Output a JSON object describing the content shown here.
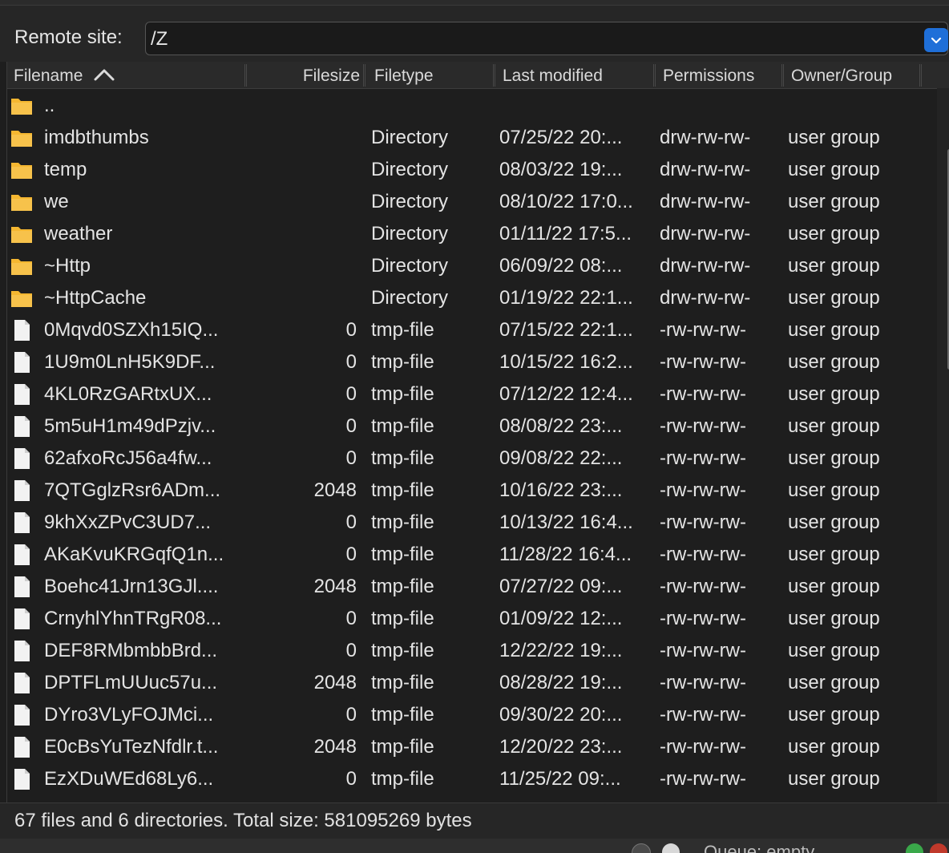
{
  "remote": {
    "label": "Remote site:",
    "path": "/Z"
  },
  "columns": {
    "filename": "Filename",
    "filesize": "Filesize",
    "filetype": "Filetype",
    "last_modified": "Last modified",
    "permissions": "Permissions",
    "owner_group": "Owner/Group"
  },
  "files": [
    {
      "icon": "folder-icon",
      "name": "..",
      "size": "",
      "type": "",
      "modified": "",
      "perms": "",
      "owner": ""
    },
    {
      "icon": "folder-icon",
      "name": "imdbthumbs",
      "size": "",
      "type": "Directory",
      "modified": "07/25/22 20:...",
      "perms": "drw-rw-rw-",
      "owner": "user group"
    },
    {
      "icon": "folder-icon",
      "name": "temp",
      "size": "",
      "type": "Directory",
      "modified": "08/03/22 19:...",
      "perms": "drw-rw-rw-",
      "owner": "user group"
    },
    {
      "icon": "folder-icon",
      "name": "we",
      "size": "",
      "type": "Directory",
      "modified": "08/10/22 17:0...",
      "perms": "drw-rw-rw-",
      "owner": "user group"
    },
    {
      "icon": "folder-icon",
      "name": "weather",
      "size": "",
      "type": "Directory",
      "modified": "01/11/22 17:5...",
      "perms": "drw-rw-rw-",
      "owner": "user group"
    },
    {
      "icon": "folder-icon",
      "name": "~Http",
      "size": "",
      "type": "Directory",
      "modified": "06/09/22 08:...",
      "perms": "drw-rw-rw-",
      "owner": "user group"
    },
    {
      "icon": "folder-icon",
      "name": "~HttpCache",
      "size": "",
      "type": "Directory",
      "modified": "01/19/22 22:1...",
      "perms": "drw-rw-rw-",
      "owner": "user group"
    },
    {
      "icon": "file-icon",
      "name": "0Mqvd0SZXh15IQ...",
      "size": "0",
      "type": "tmp-file",
      "modified": "07/15/22 22:1...",
      "perms": "-rw-rw-rw-",
      "owner": "user group"
    },
    {
      "icon": "file-icon",
      "name": "1U9m0LnH5K9DF...",
      "size": "0",
      "type": "tmp-file",
      "modified": "10/15/22 16:2...",
      "perms": "-rw-rw-rw-",
      "owner": "user group"
    },
    {
      "icon": "file-icon",
      "name": "4KL0RzGARtxUX...",
      "size": "0",
      "type": "tmp-file",
      "modified": "07/12/22 12:4...",
      "perms": "-rw-rw-rw-",
      "owner": "user group"
    },
    {
      "icon": "file-icon",
      "name": "5m5uH1m49dPzjv...",
      "size": "0",
      "type": "tmp-file",
      "modified": "08/08/22 23:...",
      "perms": "-rw-rw-rw-",
      "owner": "user group"
    },
    {
      "icon": "file-icon",
      "name": "62afxoRcJ56a4fw...",
      "size": "0",
      "type": "tmp-file",
      "modified": "09/08/22 22:...",
      "perms": "-rw-rw-rw-",
      "owner": "user group"
    },
    {
      "icon": "file-icon",
      "name": "7QTGglzRsr6ADm...",
      "size": "2048",
      "type": "tmp-file",
      "modified": "10/16/22 23:...",
      "perms": "-rw-rw-rw-",
      "owner": "user group"
    },
    {
      "icon": "file-icon",
      "name": "9khXxZPvC3UD7...",
      "size": "0",
      "type": "tmp-file",
      "modified": "10/13/22 16:4...",
      "perms": "-rw-rw-rw-",
      "owner": "user group"
    },
    {
      "icon": "file-icon",
      "name": "AKaKvuKRGqfQ1n...",
      "size": "0",
      "type": "tmp-file",
      "modified": "11/28/22 16:4...",
      "perms": "-rw-rw-rw-",
      "owner": "user group"
    },
    {
      "icon": "file-icon",
      "name": "Boehc41Jrn13GJl....",
      "size": "2048",
      "type": "tmp-file",
      "modified": "07/27/22 09:...",
      "perms": "-rw-rw-rw-",
      "owner": "user group"
    },
    {
      "icon": "file-icon",
      "name": "CrnyhlYhnTRgR08...",
      "size": "0",
      "type": "tmp-file",
      "modified": "01/09/22 12:...",
      "perms": "-rw-rw-rw-",
      "owner": "user group"
    },
    {
      "icon": "file-icon",
      "name": "DEF8RMbmbbBrd...",
      "size": "0",
      "type": "tmp-file",
      "modified": "12/22/22 19:...",
      "perms": "-rw-rw-rw-",
      "owner": "user group"
    },
    {
      "icon": "file-icon",
      "name": "DPTFLmUUuc57u...",
      "size": "2048",
      "type": "tmp-file",
      "modified": "08/28/22 19:...",
      "perms": "-rw-rw-rw-",
      "owner": "user group"
    },
    {
      "icon": "file-icon",
      "name": "DYro3VLyFOJMci...",
      "size": "0",
      "type": "tmp-file",
      "modified": "09/30/22 20:...",
      "perms": "-rw-rw-rw-",
      "owner": "user group"
    },
    {
      "icon": "file-icon",
      "name": "E0cBsYuTezNfdlr.t...",
      "size": "2048",
      "type": "tmp-file",
      "modified": "12/20/22 23:...",
      "perms": "-rw-rw-rw-",
      "owner": "user group"
    },
    {
      "icon": "file-icon",
      "name": "EzXDuWEd68Ly6...",
      "size": "0",
      "type": "tmp-file",
      "modified": "11/25/22 09:...",
      "perms": "-rw-rw-rw-",
      "owner": "user group"
    }
  ],
  "status": {
    "summary": "67 files and 6 directories. Total size: 581095269 bytes"
  },
  "bottom": {
    "queue": "Queue: empty"
  },
  "colors": {
    "folder": "#f5b731",
    "file": "#f2f2f2",
    "accent": "#1f6fd8"
  }
}
